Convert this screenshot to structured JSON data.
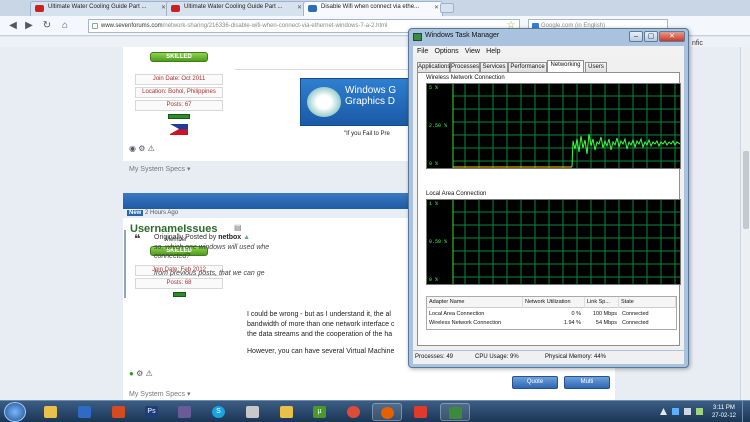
{
  "browser": {
    "tabs": [
      {
        "label": "Ultimate Water Cooling Guide Part ..."
      },
      {
        "label": "Ultimate Water Cooling Guide Part ..."
      },
      {
        "label": "Disable Wifi when connect via ethe..."
      }
    ],
    "url": "www.sevenforums.com",
    "url_path": "/network-sharing/216336-disable-wifi-when-connect-via-ethernet-windows-7-a-2.html",
    "search_placeholder": "Google.com (in English)",
    "right_clip": "nfic"
  },
  "post1": {
    "badge": "SKILLED",
    "join_date": "Join Date: Oct 2011",
    "location": "Location: Bohol, Philippines",
    "posts": "Posts: 67",
    "system_specs": "My System Specs",
    "ad_line1": "Windows G",
    "ad_line2": "Graphics D",
    "ad_caption": "\"If you Fail to Pre"
  },
  "post2": {
    "new_badge": "New",
    "time": "2 Hours Ago",
    "username": "UsernameIssues",
    "role": "Member",
    "badge": "SKILLED",
    "join_date": "Join Date: Feb 2012",
    "posts": "Posts: 68",
    "quote_by_prefix": "Originally Posted by",
    "quote_by_user": "netbox",
    "quote_line1": "so, which one windows will used whe",
    "quote_line2": "connected?",
    "quote_line3": "from previous posts, that we can ge",
    "body_line1": "I could be wrong - but as I understand it, the al",
    "body_line2": "bandwidth of more than one network interface c",
    "body_line3": "the data streams and the cooperation of the ha",
    "body_line4": "However, you can have several Virtual Machine",
    "system_specs": "My System Specs",
    "quote_btn": "Quote",
    "multi_btn": "Multi"
  },
  "taskmanager": {
    "title": "Windows Task Manager",
    "menu": [
      "File",
      "Options",
      "View",
      "Help"
    ],
    "tabs": [
      "Applications",
      "Processes",
      "Services",
      "Performance",
      "Networking",
      "Users"
    ],
    "graphs": [
      {
        "label": "Wireless Network Connection",
        "ticks": [
          "5 %",
          "2.50 %",
          "0 %"
        ]
      },
      {
        "label": "Local Area Connection",
        "ticks": [
          "1 %",
          "0.50 %",
          "0 %"
        ]
      }
    ],
    "columns": [
      "Adapter Name",
      "Network Utilization",
      "Link Sp...",
      "State"
    ],
    "rows": [
      {
        "name": "Local Area Connection",
        "util": "0 %",
        "speed": "100 Mbps",
        "state": "Connected"
      },
      {
        "name": "Wireless Network Connection",
        "util": "1.94 %",
        "speed": "54 Mbps",
        "state": "Connected"
      }
    ],
    "status": {
      "processes": "Processes: 49",
      "cpu": "CPU Usage: 9%",
      "memory": "Physical Memory: 44%"
    }
  },
  "taskbar": {
    "time": "3:11 PM",
    "date": "27-02-12"
  }
}
